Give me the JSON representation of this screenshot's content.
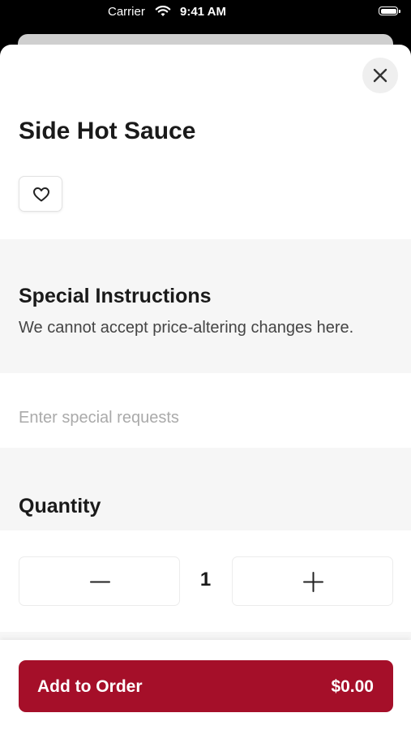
{
  "status_bar": {
    "carrier": "Carrier",
    "time": "9:41 AM",
    "wifi_icon": "wifi-icon",
    "battery_icon": "battery-icon"
  },
  "item": {
    "title": "Side Hot Sauce",
    "favorite_icon": "heart-outline-icon",
    "close_icon": "close-icon"
  },
  "special_instructions": {
    "heading": "Special Instructions",
    "description": "We cannot accept price-altering changes here.",
    "placeholder": "Enter special requests",
    "value": ""
  },
  "quantity": {
    "heading": "Quantity",
    "value": "1",
    "decrement_icon": "minus-icon",
    "increment_icon": "plus-icon"
  },
  "footer": {
    "button_label": "Add to Order",
    "price": "$0.00"
  },
  "colors": {
    "accent": "#a50f29",
    "section_background": "#f6f6f6",
    "text_primary": "#1a1a1a"
  }
}
